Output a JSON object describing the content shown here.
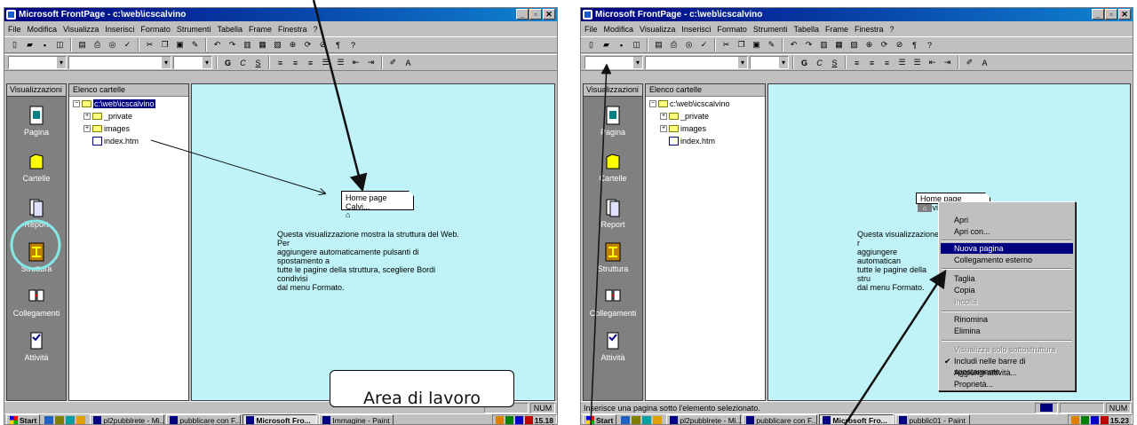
{
  "window_title": "Microsoft FrontPage - c:\\web\\icscalvino",
  "window_buttons": [
    "_",
    "▫",
    "✕"
  ],
  "menu": [
    "File",
    "Modifica",
    "Visualizza",
    "Inserisci",
    "Formato",
    "Strumenti",
    "Tabella",
    "Frame",
    "Finestra",
    "?"
  ],
  "views_panel": {
    "title": "Visualizzazioni",
    "items": [
      "Pagina",
      "Cartelle",
      "Report",
      "Struttura",
      "Collegamenti",
      "Attività"
    ]
  },
  "folder_panel": {
    "title": "Elenco cartelle",
    "root": "c:\\web\\icscalvino",
    "children": [
      "_private",
      "images",
      "index.htm"
    ]
  },
  "navigation": {
    "home_box": "Home page Calvi...",
    "hint_lines": [
      "Questa visualizzazione mostra la struttura del Web. Per",
      "aggiungere automaticamente pulsanti di spostamento a",
      "tutte le pagine della struttura, scegliere Bordi condivisi",
      "dal menu Formato."
    ],
    "hint_lines_right": [
      "Questa visualizzazione r",
      "aggiungere automatican",
      "tutte le pagine della stru",
      "dal menu Formato."
    ]
  },
  "context_menu": {
    "items": [
      {
        "label": "Apri",
        "state": "normal"
      },
      {
        "label": "Apri con...",
        "state": "normal"
      },
      {
        "label": "Nuova pagina",
        "state": "highlighted"
      },
      {
        "label": "Collegamento esterno",
        "state": "normal"
      },
      {
        "label": "Taglia",
        "state": "normal"
      },
      {
        "label": "Copia",
        "state": "normal"
      },
      {
        "label": "Incolla",
        "state": "disabled"
      },
      {
        "label": "Rinomina",
        "state": "normal"
      },
      {
        "label": "Elimina",
        "state": "normal"
      },
      {
        "label": "Visualizza solo sottostruttura",
        "state": "disabled"
      },
      {
        "label": "Includi nelle barre di spostamento",
        "state": "checked"
      },
      {
        "label": "Aggiungi attività...",
        "state": "normal"
      },
      {
        "label": "Proprietà...",
        "state": "normal"
      }
    ]
  },
  "status": {
    "left_text": "",
    "right_text": "Inserisce una pagina sotto l'elemento selezionato.",
    "num": "NUM"
  },
  "taskbar": {
    "start": "Start",
    "left_tasks": [
      "pl2pubblrete - Mi...",
      "pubblicare con F...",
      "Microsoft Fro...",
      "Immagine - Paint"
    ],
    "right_tasks": [
      "pl2pubblrete - Mi...",
      "pubblicare con F...",
      "Microsoft Fro...",
      "pubblic01 - Paint"
    ],
    "clock_left": "15.18",
    "clock_right": "15.23"
  },
  "callout": "Area di lavoro",
  "colors": {
    "workspace": "#bff3f7",
    "titlebar": "#000080",
    "highlight": "#000080"
  }
}
